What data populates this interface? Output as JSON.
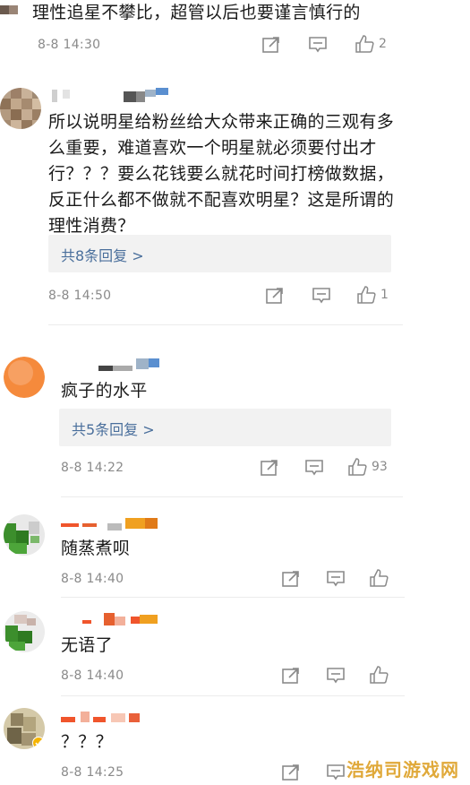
{
  "comments": [
    {
      "text": "理性追星不攀比，超管以后也要谨言慎行的",
      "time": "8-8 14:30",
      "likes": "2",
      "reply_label": ""
    },
    {
      "text": "所以说明星给粉丝给大众带来正确的三观有多么重要，难道喜欢一个明星就必须要付出才行？？？要么花钱要么就花时间打榜做数据，反正什么都不做就不配喜欢明星？这是所谓的理性消费？",
      "time": "8-8 14:50",
      "likes": "1",
      "reply_label": "共8条回复 >"
    },
    {
      "text": "疯子的水平",
      "time": "8-8 14:22",
      "likes": "93",
      "reply_label": "共5条回复 >"
    },
    {
      "text": "随蒸煮呗",
      "time": "8-8 14:40",
      "likes": "",
      "reply_label": ""
    },
    {
      "text": "无语了",
      "time": "8-8 14:40",
      "likes": "",
      "reply_label": ""
    },
    {
      "text": "？？？",
      "time": "8-8 14:25",
      "likes": "",
      "reply_label": ""
    }
  ],
  "watermark": "浩纳司游戏网",
  "icons": {
    "repost": "repost-icon",
    "comment": "comment-icon",
    "like": "thumbs-up-icon"
  },
  "colors": {
    "reply_link": "#4a6f9c",
    "meta": "#8a8a8a",
    "watermark": "#e0a93a"
  }
}
